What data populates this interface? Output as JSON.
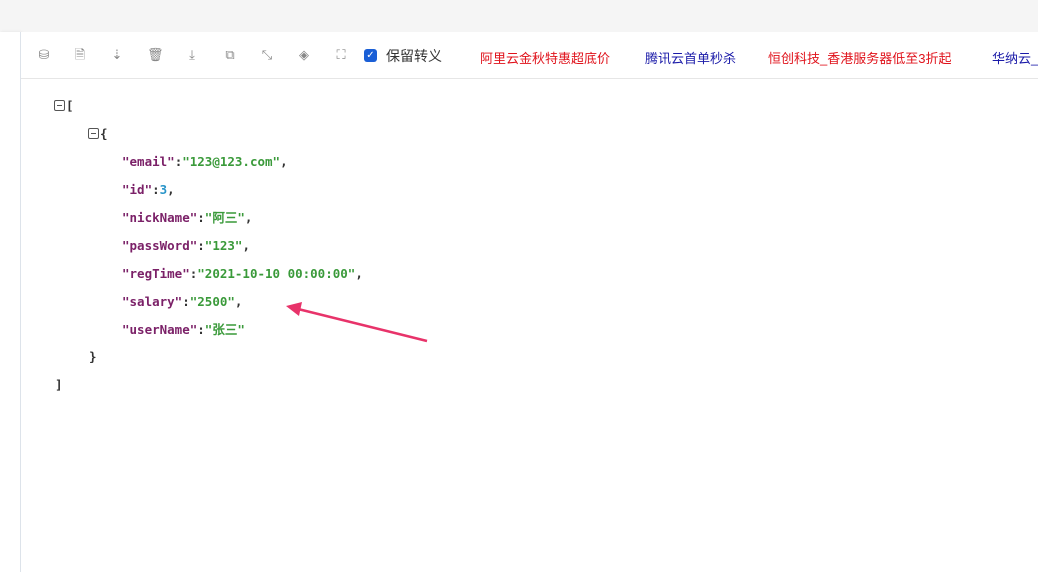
{
  "toolbar": {
    "icons": [
      "database-icon",
      "excel-icon",
      "sort-icon",
      "trash-icon",
      "download-icon",
      "copy-icon",
      "collapse-icon",
      "share-icon",
      "expand-icon"
    ],
    "keep_escape_label": "保留转义",
    "keep_escape_checked": true
  },
  "ads": [
    {
      "label": "阿里云金秋特惠超底价",
      "color": "#e0121b"
    },
    {
      "label": "腾讯云首单秒杀",
      "color": "#1a1aa8"
    },
    {
      "label": "恒创科技_香港服务器低至3折起",
      "color": "#e0121b"
    },
    {
      "label": "华纳云_",
      "color": "#1a1aa8"
    }
  ],
  "json": {
    "open_array": "[",
    "open_object": "{",
    "close_object": "}",
    "close_array": "]",
    "fields": [
      {
        "key": "\"email\"",
        "value": "\"123@123.com\"",
        "type": "s",
        "sep": ","
      },
      {
        "key": "\"id\"",
        "value": "3",
        "type": "n",
        "sep": ","
      },
      {
        "key": "\"nickName\"",
        "value": "\"阿三\"",
        "type": "s",
        "sep": ","
      },
      {
        "key": "\"passWord\"",
        "value": "\"123\"",
        "type": "s",
        "sep": ","
      },
      {
        "key": "\"regTime\"",
        "value": "\"2021-10-10 00:00:00\"",
        "type": "s",
        "sep": ","
      },
      {
        "key": "\"salary\"",
        "value": "\"2500\"",
        "type": "s",
        "sep": ","
      },
      {
        "key": "\"userName\"",
        "value": "\"张三\"",
        "type": "s",
        "sep": ""
      }
    ]
  }
}
